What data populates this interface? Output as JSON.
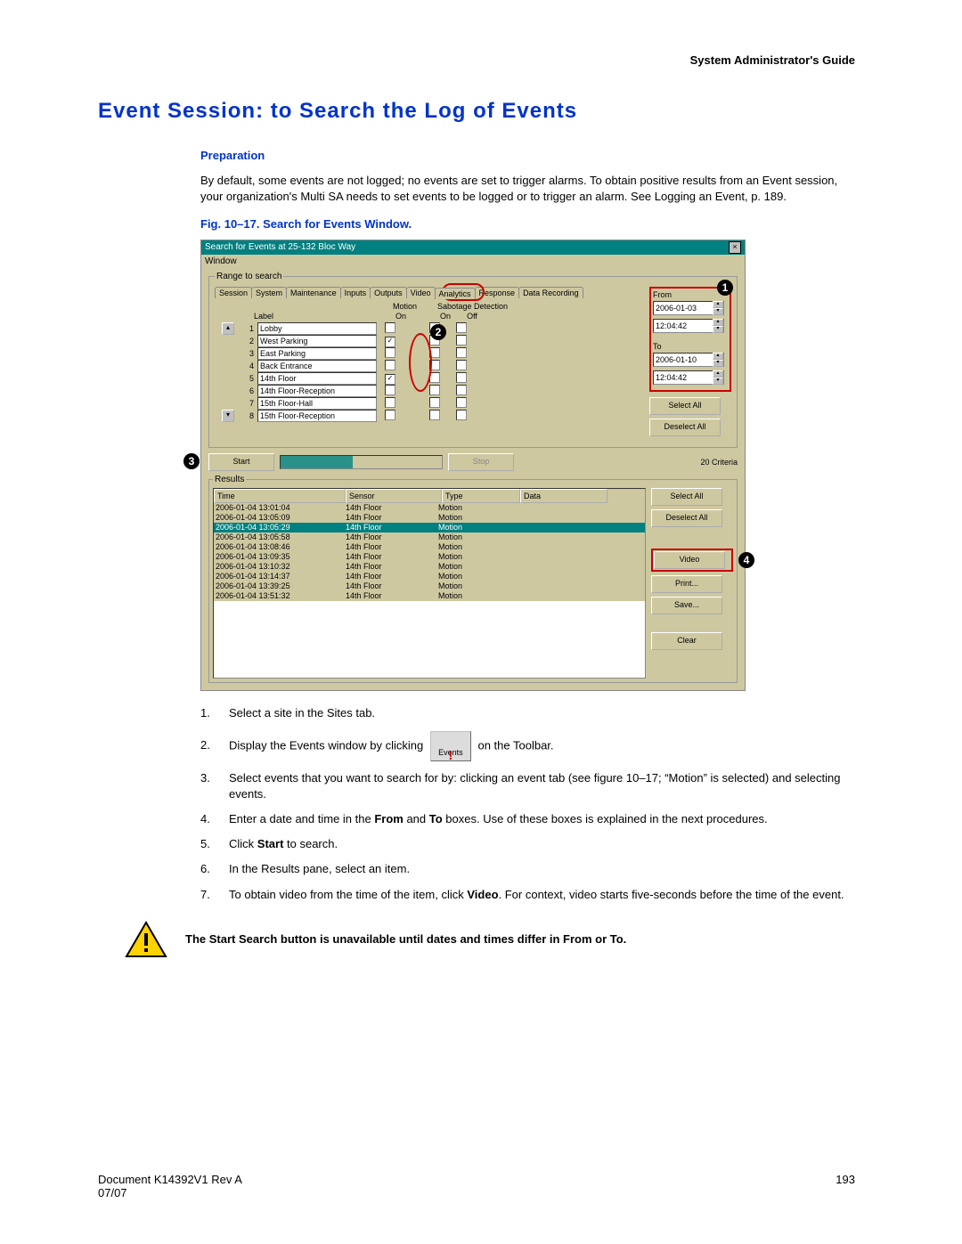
{
  "header": {
    "guide": "System Administrator's Guide"
  },
  "title": "Event Session: to Search the Log of Events",
  "preparation": {
    "heading": "Preparation",
    "text": "By default, some events are not logged; no events are set to trigger alarms. To obtain positive results from an Event session, your organization's Multi SA needs to set events to be logged or to trigger an alarm. See Logging an Event, p. 189."
  },
  "figure_caption": "Fig. 10–17.  Search for Events Window.",
  "window": {
    "title": "Search for Events at 25-132 Bloc Way",
    "menu": "Window",
    "range_legend": "Range to search",
    "tabs": [
      "Session",
      "System",
      "Maintenance",
      "Inputs",
      "Outputs",
      "Video",
      "Analytics",
      "Response",
      "Data Recording"
    ],
    "active_tab": "Analytics",
    "subcol1": "Motion",
    "subcol2": "Sabotage Detection",
    "col_label": "Label",
    "col_on": "On",
    "col_on2": "On",
    "col_off": "Off",
    "rows": [
      {
        "n": "1",
        "label": "Lobby",
        "motion": false
      },
      {
        "n": "2",
        "label": "West Parking",
        "motion": true
      },
      {
        "n": "3",
        "label": "East Parking",
        "motion": false
      },
      {
        "n": "4",
        "label": "Back Entrance",
        "motion": false
      },
      {
        "n": "5",
        "label": "14th Floor",
        "motion": true
      },
      {
        "n": "6",
        "label": "14th Floor-Reception",
        "motion": false
      },
      {
        "n": "7",
        "label": "15th Floor-Hall",
        "motion": false
      },
      {
        "n": "8",
        "label": "15th Floor-Reception",
        "motion": false
      }
    ],
    "from_label": "From",
    "from_date": "2006-01-03",
    "from_time": "12:04:42",
    "to_label": "To",
    "to_date": "2006-01-10",
    "to_time": "12:04:42",
    "select_all": "Select All",
    "deselect_all": "Deselect All",
    "start": "Start",
    "stop": "Stop",
    "criteria": "20 Criteria",
    "results_legend": "Results",
    "rh_time": "Time",
    "rh_sensor": "Sensor",
    "rh_type": "Type",
    "rh_data": "Data",
    "results": [
      {
        "time": "2006-01-04 13:01:04",
        "sensor": "14th Floor",
        "type": "Motion",
        "sel": false
      },
      {
        "time": "2006-01-04 13:05:09",
        "sensor": "14th Floor",
        "type": "Motion",
        "sel": false
      },
      {
        "time": "2006-01-04 13:05:29",
        "sensor": "14th Floor",
        "type": "Motion",
        "sel": true
      },
      {
        "time": "2006-01-04 13:05:58",
        "sensor": "14th Floor",
        "type": "Motion",
        "sel": false
      },
      {
        "time": "2006-01-04 13:08:46",
        "sensor": "14th Floor",
        "type": "Motion",
        "sel": false
      },
      {
        "time": "2006-01-04 13:09:35",
        "sensor": "14th Floor",
        "type": "Motion",
        "sel": false
      },
      {
        "time": "2006-01-04 13:10:32",
        "sensor": "14th Floor",
        "type": "Motion",
        "sel": false
      },
      {
        "time": "2006-01-04 13:14:37",
        "sensor": "14th Floor",
        "type": "Motion",
        "sel": false
      },
      {
        "time": "2006-01-04 13:39:25",
        "sensor": "14th Floor",
        "type": "Motion",
        "sel": false
      },
      {
        "time": "2006-01-04 13:51:32",
        "sensor": "14th Floor",
        "type": "Motion",
        "sel": false
      }
    ],
    "video": "Video",
    "print": "Print...",
    "save": "Save...",
    "clear": "Clear"
  },
  "callouts": {
    "c1": "1",
    "c2": "2",
    "c3": "3",
    "c4": "4"
  },
  "steps": {
    "s1": {
      "n": "1.",
      "t": "Select a site in the Sites tab."
    },
    "s2": {
      "n": "2.",
      "t_a": "Display the Events window by clicking",
      "btn": "Events",
      "t_b": " on the Toolbar."
    },
    "s3": {
      "n": "3.",
      "t": "Select events that you want to search for by: clicking an event tab (see figure 10–17; “Motion” is selected) and selecting events."
    },
    "s4": {
      "n": "4.",
      "t_a": "Enter a date and time in the ",
      "b1": "From",
      "t_b": " and ",
      "b2": "To",
      "t_c": " boxes. Use of these boxes is explained in the next procedures."
    },
    "s5": {
      "n": "5.",
      "t_a": "Click ",
      "b": "Start",
      "t_b": " to search."
    },
    "s6": {
      "n": "6.",
      "t": "In the Results pane, select an item."
    },
    "s7": {
      "n": "7.",
      "t_a": "To obtain video from the time of the item, click ",
      "b": "Video",
      "t_b": ". For context, video starts five-seconds before the time of the event."
    }
  },
  "warning": "The Start Search button is unavailable until dates and times differ in From or To.",
  "footer": {
    "doc": "Document K14392V1 Rev A",
    "date": "07/07",
    "page": "193"
  }
}
